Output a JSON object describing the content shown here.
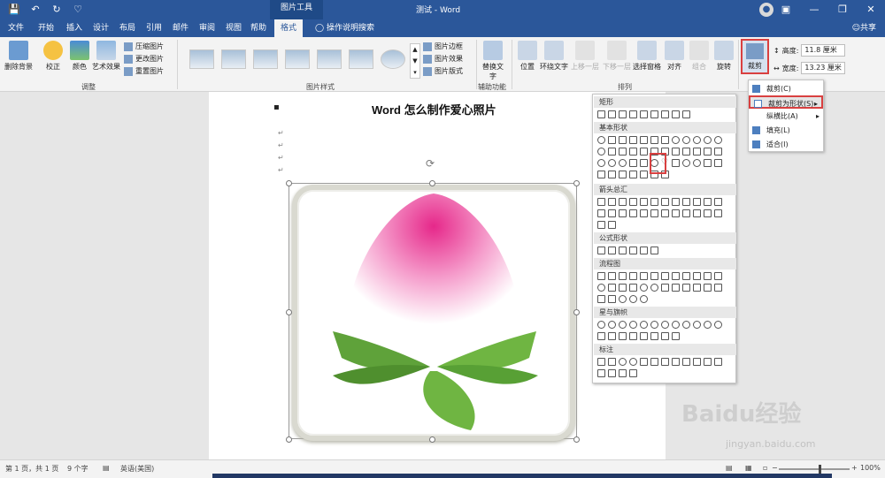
{
  "titlebar": {
    "context_tools": "图片工具",
    "title": "测试 - Word",
    "qat": [
      "save-icon",
      "undo-icon",
      "redo-icon",
      "customize-icon"
    ]
  },
  "tabs": [
    {
      "label": "文件"
    },
    {
      "label": "开始"
    },
    {
      "label": "插入"
    },
    {
      "label": "设计"
    },
    {
      "label": "布局"
    },
    {
      "label": "引用"
    },
    {
      "label": "邮件"
    },
    {
      "label": "审阅"
    },
    {
      "label": "视图"
    },
    {
      "label": "帮助"
    },
    {
      "label": "格式"
    }
  ],
  "tell_me": "操作说明搜索",
  "share": "共享",
  "ribbon": {
    "remove_bg": "删除背景",
    "corrections": "校正",
    "color": "颜色",
    "artistic": "艺术效果",
    "compress": "压缩图片",
    "change": "更改图片",
    "reset": "重置图片",
    "adjust_group": "调整",
    "styles_group": "图片样式",
    "border": "图片边框",
    "effects": "图片效果",
    "layout": "图片版式",
    "alt_text": "替换文字",
    "accessibility_group": "辅助功能",
    "position": "位置",
    "wrap": "环绕文字",
    "forward": "上移一层",
    "backward": "下移一层",
    "selection_pane": "选择窗格",
    "align": "对齐",
    "group": "组合",
    "rotate": "旋转",
    "arrange_group": "排列",
    "crop": "裁剪",
    "height_label": "高度:",
    "height_value": "11.8 厘米",
    "width_label": "宽度:",
    "width_value": "13.23 厘米"
  },
  "document": {
    "heading": "Word 怎么制作爱心照片",
    "para_mark": "↵"
  },
  "shapes_menu": {
    "sections": [
      "矩形",
      "基本形状",
      "箭头总汇",
      "公式形状",
      "流程图",
      "星与旗帜",
      "标注"
    ]
  },
  "crop_menu": {
    "items": [
      "裁剪(C)",
      "裁剪为形状(S)",
      "纵横比(A)",
      "填充(L)",
      "适合(I)"
    ]
  },
  "status": {
    "page": "第 1 页，共 1 页",
    "words": "9 个字",
    "lang": "英语(美国)",
    "zoom": "100%"
  },
  "watermark": {
    "main": "Baidu经验",
    "sub": "jingyan.baidu.com"
  },
  "colors": {
    "accent": "#2b579a",
    "highlight": "#d94040"
  }
}
